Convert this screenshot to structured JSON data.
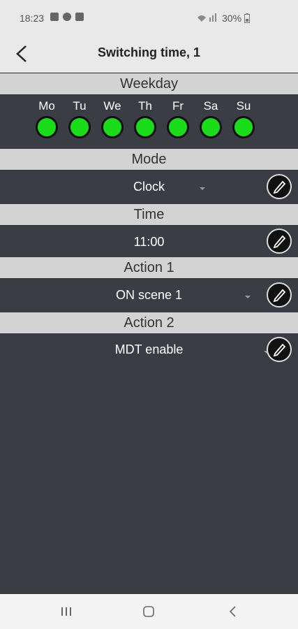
{
  "status": {
    "time": "18:23",
    "battery": "30%"
  },
  "header": {
    "title": "Switching time, 1",
    "back_icon": "chevron-left-icon"
  },
  "weekday": {
    "label": "Weekday",
    "days": [
      {
        "label": "Mo",
        "active": true
      },
      {
        "label": "Tu",
        "active": true
      },
      {
        "label": "We",
        "active": true
      },
      {
        "label": "Th",
        "active": true
      },
      {
        "label": "Fr",
        "active": true
      },
      {
        "label": "Sa",
        "active": true
      },
      {
        "label": "Su",
        "active": true
      }
    ]
  },
  "mode": {
    "label": "Mode",
    "value": "Clock"
  },
  "time": {
    "label": "Time",
    "value": "11:00"
  },
  "action1": {
    "label": "Action 1",
    "value": "ON scene 1"
  },
  "action2": {
    "label": "Action 2",
    "value": "MDT enable"
  },
  "colors": {
    "active_day": "#1bdc1b",
    "header_bg": "#d3d3d3",
    "row_bg": "#3a3e44"
  }
}
